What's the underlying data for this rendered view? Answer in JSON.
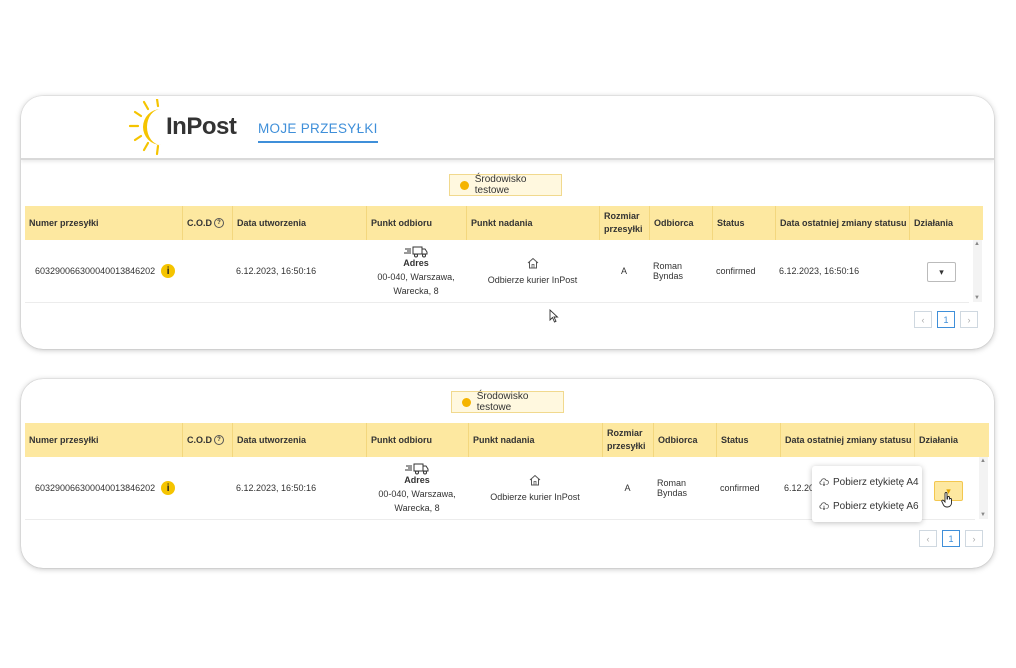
{
  "app": {
    "logo_text": "InPost",
    "nav_tab": "MOJE PRZESYŁKI"
  },
  "notice": {
    "text": "Środowisko testowe"
  },
  "columns": {
    "number": "Numer przesyłki",
    "cod": "C.O.D",
    "created": "Data utworzenia",
    "pickup": "Punkt odbioru",
    "send": "Punkt nadania",
    "size_line1": "Rozmiar",
    "size_line2": "przesyłki",
    "recipient": "Odbiorca",
    "status": "Status",
    "last_change": "Data ostatniej zmiany statusu",
    "actions": "Działania"
  },
  "shipment": {
    "number": "603290066300040013846202",
    "created": "6.12.2023, 16:50:16",
    "pickup_label": "Adres",
    "pickup_line1": "00-040, Warszawa,",
    "pickup_line2": "Warecka, 8",
    "send_point": "Odbierze kurier InPost",
    "size": "A",
    "recipient": "Roman Byndas",
    "status": "confirmed",
    "last_change": "6.12.2023, 16:50:16",
    "last_change_truncated": "6.12.20"
  },
  "pagination": {
    "current": "1",
    "prev": "‹",
    "next": "›"
  },
  "actions_menu": {
    "toggle": "▾",
    "items": [
      "Pobierz etykietę A4",
      "Pobierz etykietę A6"
    ]
  }
}
